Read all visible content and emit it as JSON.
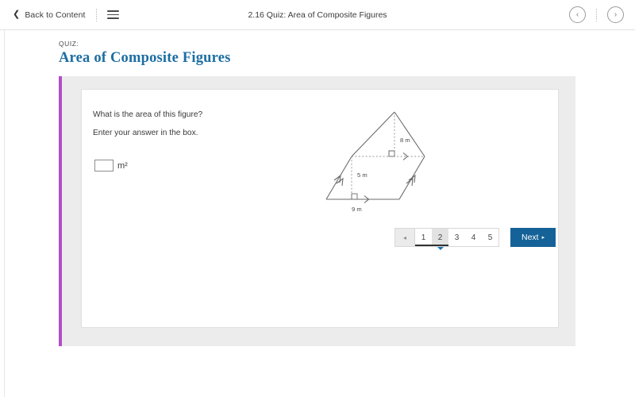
{
  "topbar": {
    "back_label": "Back to Content",
    "back_icon": "chevron-left-icon",
    "menu_icon": "hamburger-menu-icon",
    "title": "2.16 Quiz: Area of Composite Figures",
    "prev_icon": "‹",
    "next_icon": "›"
  },
  "heading": {
    "kicker": "QUIZ:",
    "title": "Area of Composite Figures",
    "title_color": "#1c6ea4",
    "accent_bar_color": "#b24fc7"
  },
  "question": {
    "prompt": "What is the area of this figure?",
    "instruction": "Enter your answer in the box.",
    "answer_value": "",
    "answer_placeholder": "",
    "unit": "m²"
  },
  "figure": {
    "type": "composite-figure-parallelogram-triangle",
    "labels": {
      "triangle_height": "8 m",
      "parallelogram_height": "5 m",
      "base": "9 m"
    },
    "stroke_color": "#6b6b6b",
    "dash_color": "#9a9a9a"
  },
  "pagination": {
    "prev_icon": "◂",
    "pages": [
      {
        "label": "1",
        "state": "visited"
      },
      {
        "label": "2",
        "state": "active"
      },
      {
        "label": "3",
        "state": "unvisited"
      },
      {
        "label": "4",
        "state": "unvisited"
      },
      {
        "label": "5",
        "state": "unvisited"
      }
    ],
    "next_label": "Next",
    "next_caret": "▸",
    "next_color": "#156298"
  }
}
